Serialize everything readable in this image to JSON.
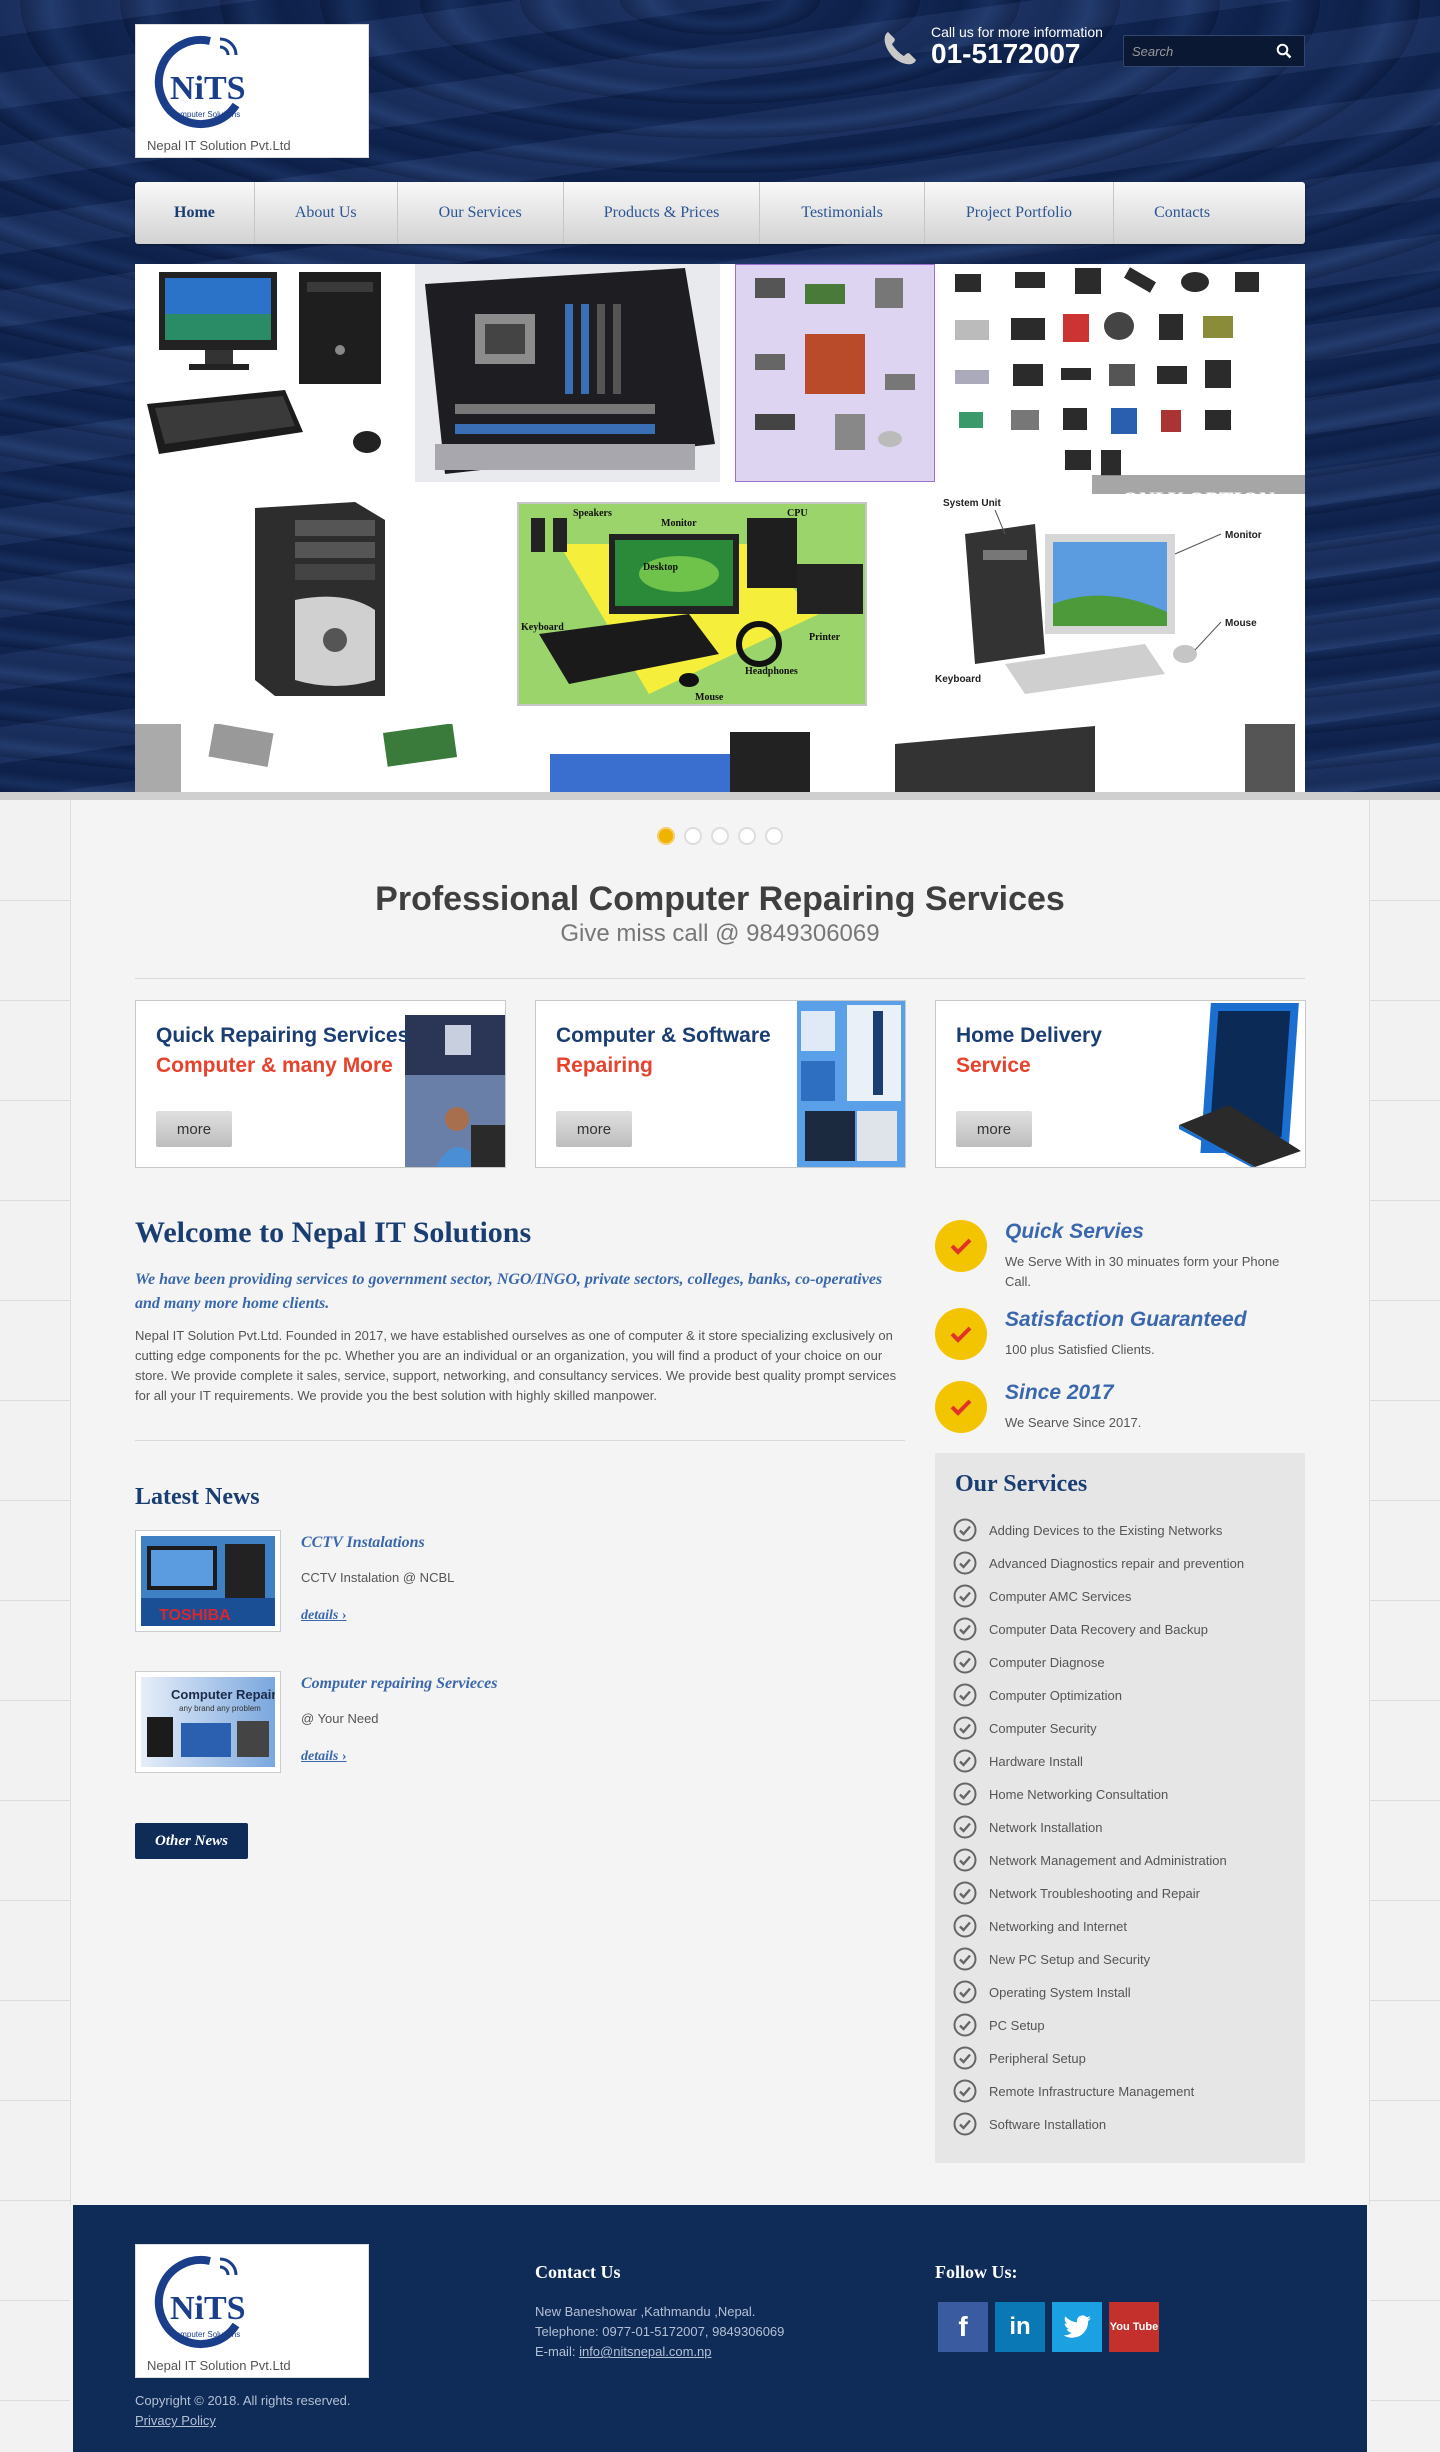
{
  "brand": {
    "logo_letters": "NiTS",
    "logo_tagline": "Computer Solutions",
    "company": "Nepal IT Solution Pvt.Ltd"
  },
  "header": {
    "call_label": "Call us for more information",
    "call_number": "01-5172007",
    "search_placeholder": "Search"
  },
  "nav": {
    "items": [
      "Home",
      "About Us",
      "Our Services",
      "Products & Prices",
      "Testimonials",
      "Project Portfolio",
      "Contacts"
    ],
    "active": "Home"
  },
  "slider": {
    "caption": "ONLY OPTION",
    "slide_count": 5,
    "active_slide": 1,
    "labels": {
      "speakers": "Speakers",
      "monitor": "Monitor",
      "cpu": "CPU",
      "desktop": "Desktop",
      "keyboard": "Keyboard",
      "printer": "Printer",
      "headphones": "Headphones",
      "mouse": "Mouse",
      "system_unit": "System Unit",
      "monitor2": "Monitor",
      "mouse2": "Mouse",
      "keyboard2": "Keyboard"
    }
  },
  "intro": {
    "title": "Professional Computer Repairing Services",
    "subtitle": "Give miss call @ 9849306069"
  },
  "features": [
    {
      "title": "Quick Repairing Services",
      "subtitle": "Computer & many More",
      "button": "more"
    },
    {
      "title": "Computer & Software",
      "subtitle": "Repairing",
      "button": "more"
    },
    {
      "title": "Home Delivery",
      "subtitle": "Service",
      "button": "more"
    }
  ],
  "welcome": {
    "title": "Welcome to Nepal IT Solutions",
    "lead": "We have been providing services to government sector, NGO/INGO, private sectors, colleges, banks, co-operatives and many more home clients.",
    "body": "Nepal IT Solution Pvt.Ltd. Founded in 2017, we have established ourselves as one of computer & it store specializing exclusively on cutting edge components for the pc. Whether you are an individual or an organization, you will find a product of your choice on our store. We provide complete it sales, service, support, networking, and consultancy services. We provide best quality prompt services for all your IT requirements. We provide you the best solution with highly skilled manpower."
  },
  "news": {
    "title": "Latest News",
    "items": [
      {
        "headline": "CCTV Instalations",
        "summary": "CCTV Instalation @ NCBL",
        "link": "details",
        "thumb_text": "TOSHIBA"
      },
      {
        "headline": "Computer repairing Servieces",
        "summary": "@ Your Need",
        "link": "details",
        "thumb_text": "Computer Repair",
        "thumb_sub": "any brand any problem"
      }
    ],
    "other_button": "Other News"
  },
  "highlights": [
    {
      "title": "Quick Servies",
      "text": "We Serve With in 30 minuates form your Phone Call."
    },
    {
      "title": "Satisfaction Guaranteed",
      "text": "100 plus Satisfied Clients."
    },
    {
      "title": "Since 2017",
      "text": "We Searve Since 2017."
    }
  ],
  "services": {
    "title": "Our Services",
    "items": [
      "Adding Devices to the Existing Networks",
      "Advanced Diagnostics repair and prevention",
      "Computer AMC Services",
      "Computer Data Recovery and Backup",
      "Computer Diagnose",
      "Computer Optimization",
      "Computer Security",
      "Hardware Install",
      "Home Networking Consultation",
      "Network Installation",
      "Network Management and Administration",
      "Network Troubleshooting and Repair",
      "Networking and Internet",
      "New PC Setup and Security",
      "Operating System Install",
      "PC Setup",
      "Peripheral Setup",
      "Remote Infrastructure Management",
      "Software Installation"
    ]
  },
  "footer": {
    "copyright": "Copyright © 2018. All rights reserved.",
    "privacy": "Privacy Policy",
    "contact_title": "Contact Us",
    "address": "New Baneshowar ,Kathmandu ,Nepal.",
    "telephone": "Telephone: 0977-01-5172007, 9849306069",
    "email_label": "E-mail:",
    "email": "info@nitsnepal.com.np",
    "follow_title": "Follow Us:",
    "social": [
      {
        "name": "facebook",
        "glyph": "f",
        "color": "#3b5ba0"
      },
      {
        "name": "linkedin",
        "glyph": "in",
        "color": "#0a78b5"
      },
      {
        "name": "twitter",
        "glyph": "t",
        "color": "#1ba0e1"
      },
      {
        "name": "youtube",
        "glyph": "You Tube",
        "color": "#c4302b"
      }
    ]
  },
  "colors": {
    "navy": "#0f2c58",
    "accent_red": "#e8412c",
    "badge_yellow": "#f3c400",
    "link_blue": "#3b68ad"
  }
}
